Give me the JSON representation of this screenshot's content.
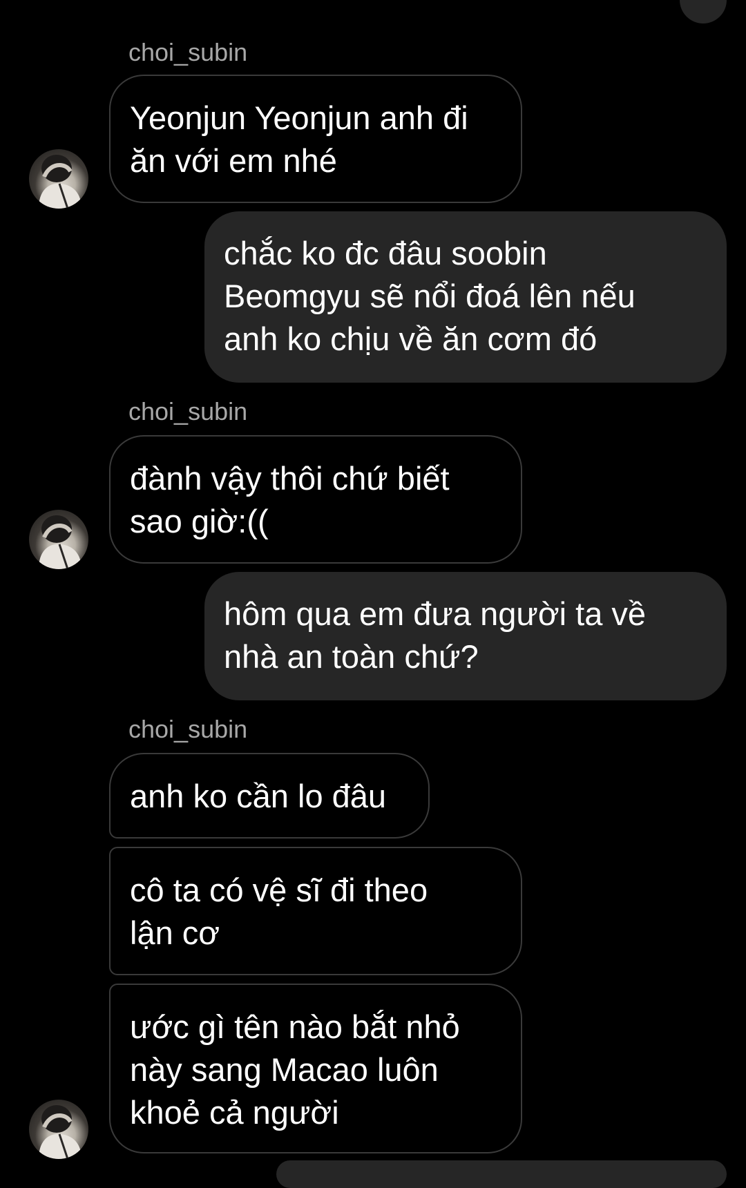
{
  "sender_name": "choi_subin",
  "messages": [
    {
      "from": "them",
      "text": "Yeonjun Yeonjun anh đi\năn với em nhé"
    },
    {
      "from": "me",
      "text": "chắc ko đc đâu soobin\nBeomgyu sẽ nổi đoá lên nếu\nanh ko chịu về ăn cơm đó"
    },
    {
      "from": "them",
      "text": "đành vậy thôi chứ biết\nsao giờ:(("
    },
    {
      "from": "me",
      "text": "hôm qua em đưa người ta về\nnhà an toàn chứ?"
    },
    {
      "from": "them",
      "text": "anh ko cần lo đâu"
    },
    {
      "from": "them",
      "text": "cô ta có vệ sĩ đi theo\nlận cơ"
    },
    {
      "from": "them",
      "text": "ước gì tên nào bắt nhỏ\nnày sang Macao luôn\nkhoẻ cả người"
    }
  ],
  "colors": {
    "background": "#000000",
    "outgoing_bubble": "#262626",
    "incoming_border": "#3a3a3a",
    "sender_name": "#a8a8a8",
    "text": "#ffffff"
  },
  "icons": {
    "avatar": "profile-avatar"
  }
}
